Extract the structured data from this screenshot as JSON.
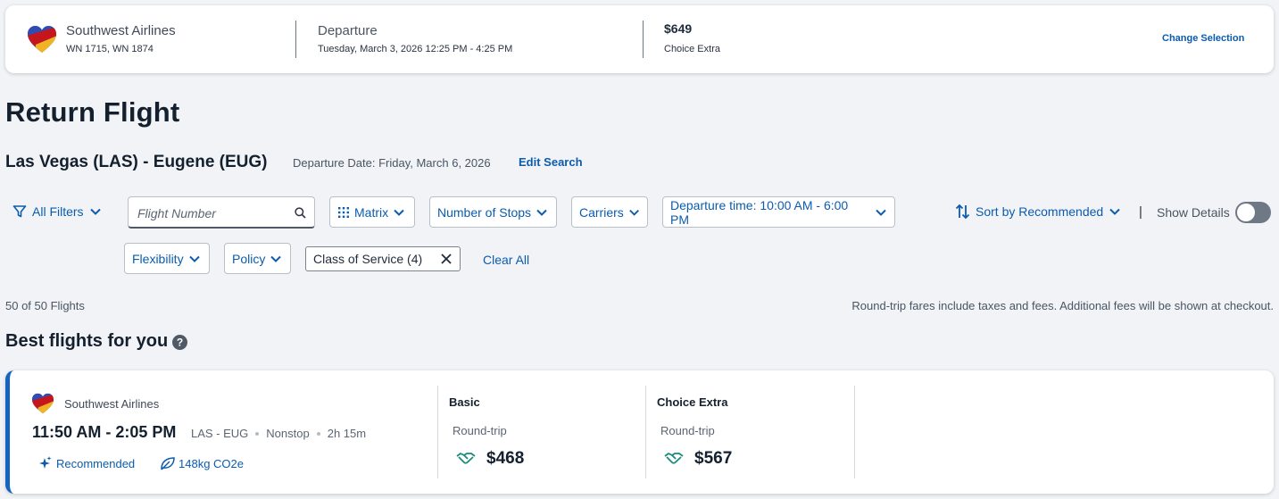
{
  "selected_flight": {
    "airline": "Southwest Airlines",
    "flight_numbers": "WN 1715, WN 1874",
    "departure_label": "Departure",
    "departure_value": "Tuesday, March 3, 2026 12:25 PM - 4:25 PM",
    "price": "$649",
    "fare_class": "Choice Extra",
    "change_label": "Change Selection"
  },
  "page_title": "Return Flight",
  "route": "Las Vegas (LAS) - Eugene (EUG)",
  "departure_date": "Departure Date: Friday, March 6, 2026",
  "edit_search": "Edit Search",
  "filters": {
    "all_filters": "All Filters",
    "flight_number_placeholder": "Flight Number",
    "matrix": "Matrix",
    "stops": "Number of Stops",
    "carriers": "Carriers",
    "departure_time": "Departure time: 10:00 AM - 6:00 PM",
    "sort": "Sort by Recommended",
    "divider": "|",
    "show_details": "Show Details",
    "show_details_on": false,
    "flexibility": "Flexibility",
    "policy": "Policy",
    "class_of_service_chip": "Class of Service (4)",
    "clear_all": "Clear All"
  },
  "results_count": "50 of 50 Flights",
  "fare_note": "Round-trip fares include taxes and fees. Additional fees will be shown at checkout.",
  "best_flights_title": "Best flights for you",
  "flights": [
    {
      "airline": "Southwest Airlines",
      "times": "11:50 AM - 2:05 PM",
      "route": "LAS - EUG",
      "stops": "Nonstop",
      "duration": "2h 15m",
      "tag": "Recommended",
      "co2": "148kg CO2e",
      "fares": [
        {
          "name": "Basic",
          "trip": "Round-trip",
          "price": "$468"
        },
        {
          "name": "Choice Extra",
          "trip": "Round-trip",
          "price": "$567"
        }
      ]
    }
  ],
  "colors": {
    "link": "#0b5cad",
    "accent_bar": "#1565c0",
    "background": "#f1f3f6",
    "eco_icon": "#1a8a7a"
  },
  "icons": [
    "southwest-heart-logo",
    "filter-icon",
    "chevron-down-icon",
    "search-icon",
    "matrix-grid-icon",
    "sort-arrows-icon",
    "close-icon",
    "help-icon",
    "sparkle-icon",
    "leaf-icon",
    "handshake-icon"
  ]
}
